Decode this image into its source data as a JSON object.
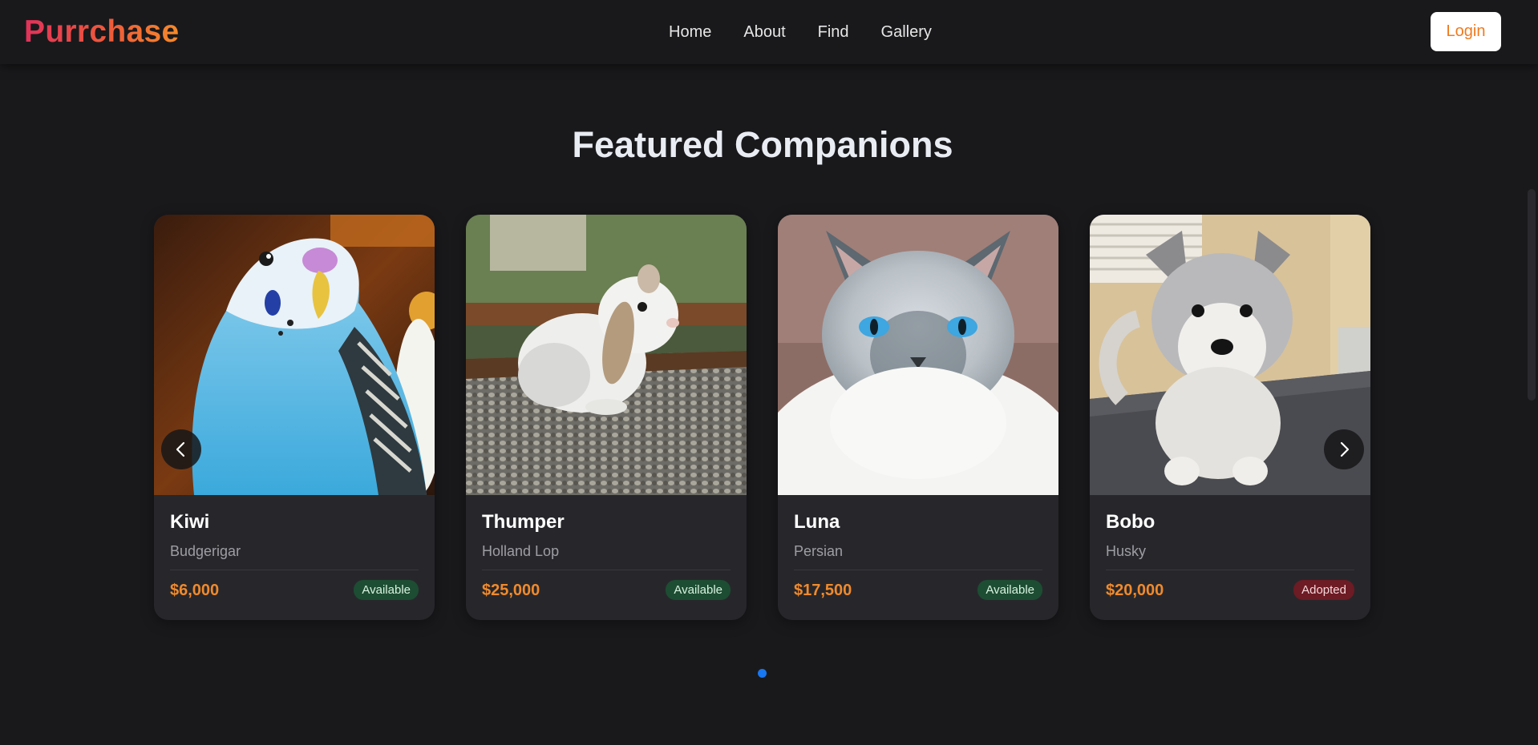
{
  "header": {
    "brand": "Purrchase",
    "nav": [
      "Home",
      "About",
      "Find",
      "Gallery"
    ],
    "login_label": "Login"
  },
  "main": {
    "title": "Featured Companions",
    "pets": [
      {
        "name": "Kiwi",
        "breed": "Budgerigar",
        "price": "$6,000",
        "status": "Available",
        "photo": "budgerigar-photo"
      },
      {
        "name": "Thumper",
        "breed": "Holland Lop",
        "price": "$25,000",
        "status": "Available",
        "photo": "rabbit-photo"
      },
      {
        "name": "Luna",
        "breed": "Persian",
        "price": "$17,500",
        "status": "Available",
        "photo": "cat-photo"
      },
      {
        "name": "Bobo",
        "breed": "Husky",
        "price": "$20,000",
        "status": "Adopted",
        "photo": "puppy-photo"
      }
    ],
    "carousel": {
      "prev_icon": "chevron-left-icon",
      "next_icon": "chevron-right-icon",
      "page_count": 1,
      "active_page": 1
    }
  },
  "colors": {
    "background": "#19191c",
    "card": "#27272b",
    "price": "#f08a2c",
    "available": "#1d4d33",
    "adopted": "#6d1b24",
    "dot": "#1877f2",
    "login_text": "#f07a1e"
  }
}
